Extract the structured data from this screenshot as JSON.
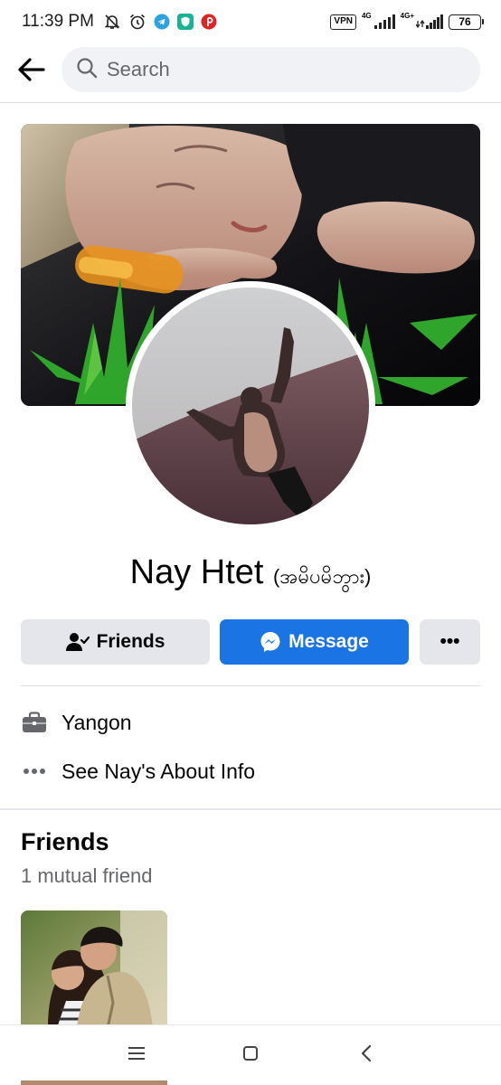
{
  "status_bar": {
    "time": "11:39 PM",
    "icons_left": [
      "mute-bell-icon",
      "alarm-clock-icon",
      "telegram-icon",
      "shield-app-icon",
      "pinterest-icon"
    ],
    "vpn": "VPN",
    "net1": "4G",
    "net2": "4G+",
    "battery": "76"
  },
  "search": {
    "placeholder": "Search"
  },
  "profile": {
    "name": "Nay Htet",
    "alt_name": "(အမိပမိဘွား)"
  },
  "actions": {
    "friends_label": "Friends",
    "message_label": "Message",
    "more_label": "•••"
  },
  "intro": {
    "work": "Yangon",
    "about": "See Nay's About Info"
  },
  "friends_section": {
    "title": "Friends",
    "mutual": "1 mutual friend"
  },
  "colors": {
    "accent": "#1b74e4",
    "button_gray": "#e4e6eb",
    "secondary_text": "#65676b"
  }
}
